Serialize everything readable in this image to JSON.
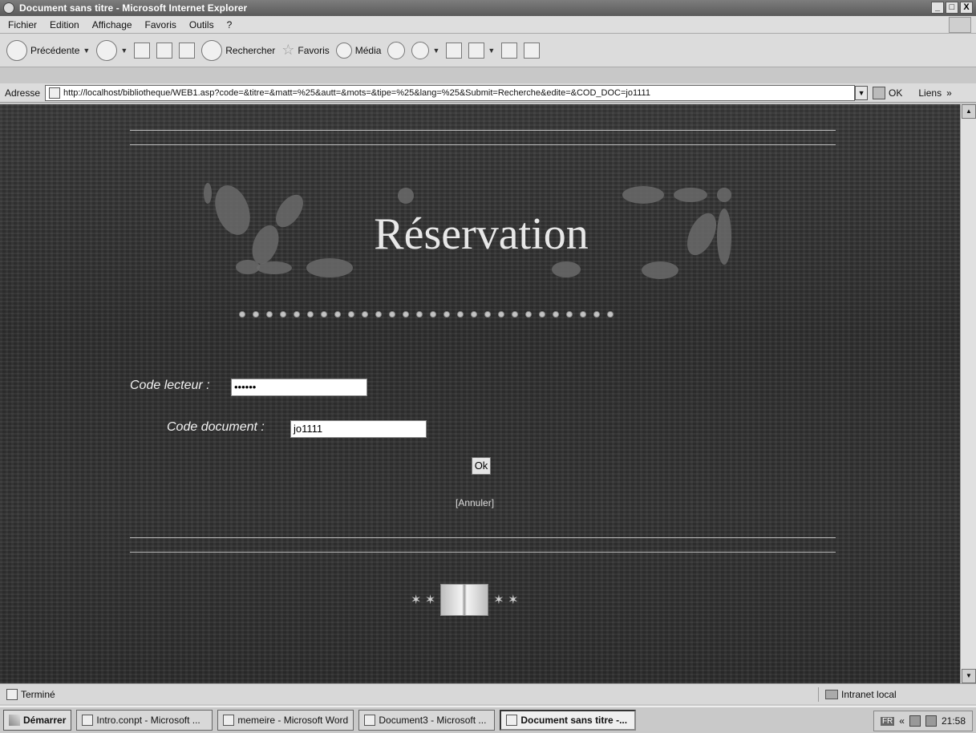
{
  "window": {
    "title": "Document sans titre - Microsoft Internet Explorer",
    "minimize": "_",
    "maximize": "□",
    "close": "X"
  },
  "menu": [
    "Fichier",
    "Edition",
    "Affichage",
    "Favoris",
    "Outils",
    "?"
  ],
  "toolbar": {
    "back_label": "Précédente",
    "search_label": "Rechercher",
    "favorites_label": "Favoris",
    "media_label": "Média"
  },
  "address": {
    "label": "Adresse",
    "url": "http://localhost/bibliotheque/WEB1.asp?code=&titre=&matt=%25&autt=&mots=&tipe=%25&lang=%25&Submit=Recherche&edite=&COD_DOC=jo1111",
    "go_label": "OK",
    "links_label": "Liens"
  },
  "page": {
    "heading": "Réservation",
    "code_lecteur_label": "Code lecteur :",
    "code_lecteur_value": "••••••",
    "code_document_label": "Code document :",
    "code_document_value": "jo1111",
    "ok_label": "Ok",
    "cancel_label": "[Annuler]",
    "footer_stars_left": "✶ ✶",
    "footer_stars_right": "✶ ✶"
  },
  "status": {
    "text": "Terminé",
    "zone": "Intranet local"
  },
  "taskbar": {
    "start_label": "Démarrer",
    "tasks": [
      {
        "label": "Intro.conpt - Microsoft ..."
      },
      {
        "label": "memeire - Microsoft Word"
      },
      {
        "label": "Document3 - Microsoft ..."
      },
      {
        "label": "Document sans titre -..."
      }
    ],
    "tray_lang": "FR",
    "tray_arrows": "«",
    "clock": "21:58"
  }
}
